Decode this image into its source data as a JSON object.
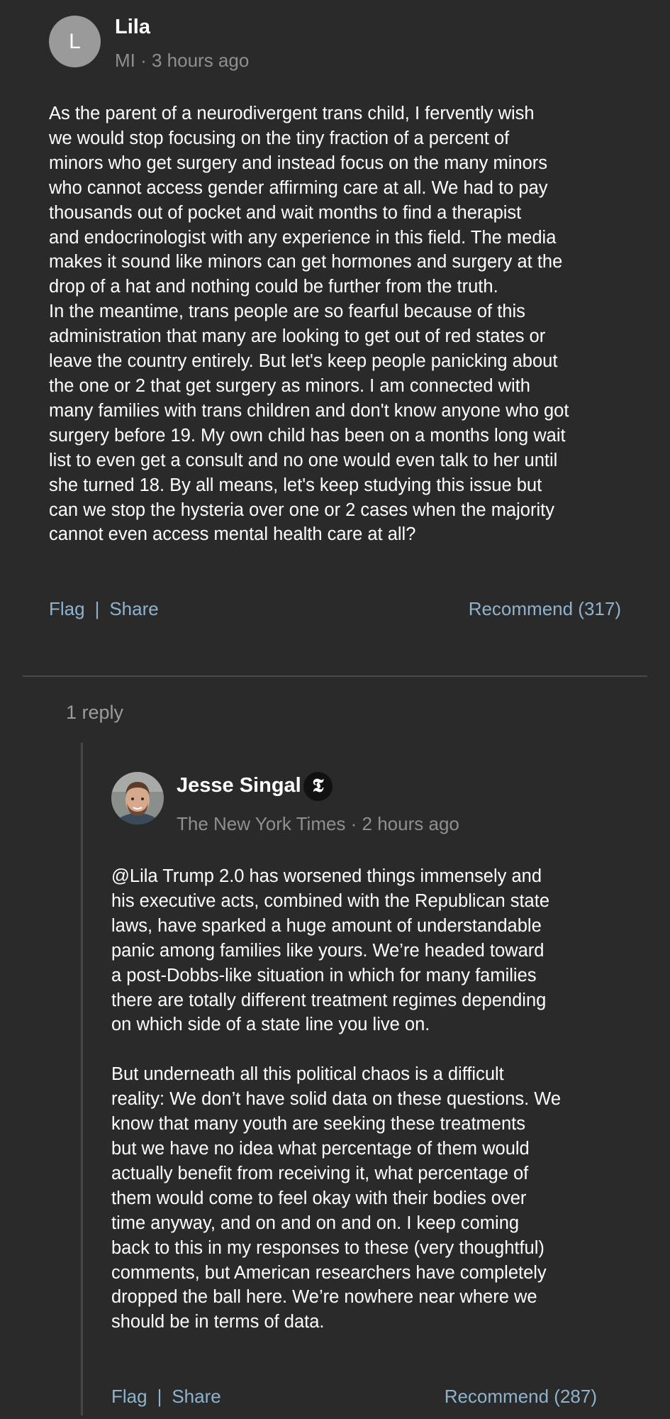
{
  "comment": {
    "avatar_letter": "L",
    "author": "Lila",
    "meta": "MI · 3 hours ago",
    "body": "As the parent of a neurodivergent trans child, I fervently wish\nwe would stop focusing on the tiny fraction of a percent of\nminors who get surgery and instead focus on the many minors\nwho cannot access gender affirming care at all. We had to pay\nthousands out of pocket and wait months to find a therapist\nand endocrinologist with any experience in this field. The media\nmakes it sound like minors can get hormones and surgery at the\ndrop of a hat and nothing could be further from the truth.\nIn the meantime, trans people are so fearful because of this\nadministration that many are looking to get out of red states or\nleave the country entirely. But let's keep people panicking about\nthe one or 2 that get surgery as minors. I am connected with\nmany families with trans children and don't know anyone who got\nsurgery before 19. My own child has been on a months long wait\nlist to even get a consult and no one would even talk to her until\nshe turned 18. By all means, let's keep studying this issue but\ncan we stop the hysteria over one or 2 cases when the majority\ncannot even access mental health care at all?",
    "flag_label": "Flag",
    "separator": "|",
    "share_label": "Share",
    "recommend_label": "Recommend (317)"
  },
  "replies": {
    "count_label": "1 reply"
  },
  "reply": {
    "author": "Jesse Singal",
    "badge_glyph": "𝕿",
    "meta": "The New York Times · 2 hours ago",
    "body": "@Lila Trump 2.0 has worsened things immensely and\nhis executive acts, combined with the Republican state\nlaws, have sparked a huge amount of understandable\npanic among families like yours. We’re headed toward\na post-Dobbs-like situation in which for many families\nthere are totally different treatment regimes depending\non which side of a state line you live on.\n\nBut underneath all this political chaos is a difficult\nreality: We don’t have solid data on these questions. We\nknow that many youth are seeking these treatments\nbut we have no idea what percentage of them would\nactually benefit from receiving it, what percentage of\nthem would come to feel okay with their bodies over\ntime anyway, and on and on and on. I keep coming\nback to this in my responses to these (very thoughtful)\ncomments, but American researchers have completely\ndropped the ball here. We’re nowhere near where we\nshould be in terms of data.",
    "flag_label": "Flag",
    "separator": "|",
    "share_label": "Share",
    "recommend_label": "Recommend (287)"
  },
  "colors": {
    "background": "#2a2a2a",
    "link": "#8fb2cd",
    "meta": "#8f8f8f",
    "divider": "#4a4a4a"
  }
}
